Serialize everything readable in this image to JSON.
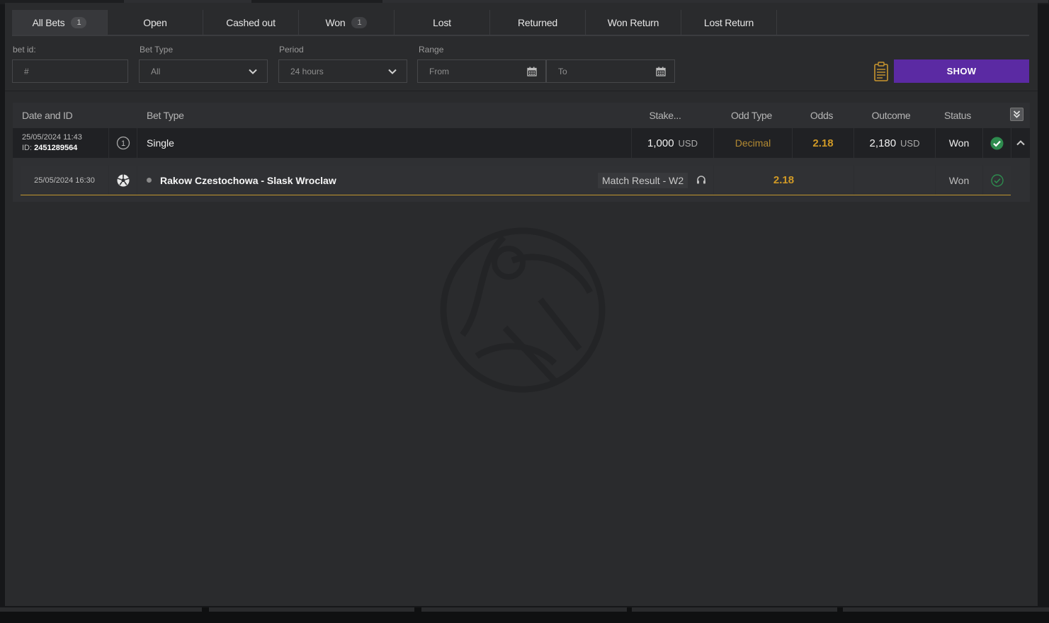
{
  "tabs": [
    {
      "label": "All Bets",
      "count": "1",
      "active": true
    },
    {
      "label": "Open"
    },
    {
      "label": "Cashed out"
    },
    {
      "label": "Won",
      "count": "1"
    },
    {
      "label": "Lost"
    },
    {
      "label": "Returned"
    },
    {
      "label": "Won Return"
    },
    {
      "label": "Lost Return"
    }
  ],
  "filters": {
    "bet_id_label": "bet id:",
    "bet_id_placeholder": "#",
    "bet_type_label": "Bet Type",
    "bet_type_value": "All",
    "period_label": "Period",
    "period_value": "24 hours",
    "range_label": "Range",
    "from_placeholder": "From",
    "to_placeholder": "To",
    "show_label": "SHOW"
  },
  "table": {
    "headers": {
      "date_id": "Date and ID",
      "bet_type": "Bet Type",
      "stake": "Stake...",
      "odd_type": "Odd Type",
      "odds": "Odds",
      "outcome": "Outcome",
      "status": "Status"
    },
    "bet": {
      "date": "25/05/2024 11:43",
      "id_label": "ID:",
      "id": "2451289564",
      "count_badge": "1",
      "type": "Single",
      "stake": "1,000",
      "stake_currency": "USD",
      "odd_type": "Decimal",
      "odds": "2.18",
      "outcome": "2,180",
      "outcome_currency": "USD",
      "status": "Won"
    },
    "selection": {
      "date": "25/05/2024 16:30",
      "event": "Rakow Czestochowa - Slask Wroclaw",
      "market": "Match Result - W2",
      "odds": "2.18",
      "status": "Won"
    }
  },
  "colors": {
    "accent_purple": "#5b2aa3",
    "odds_gold": "#d19a26",
    "won_green": "#2e8b4e"
  }
}
